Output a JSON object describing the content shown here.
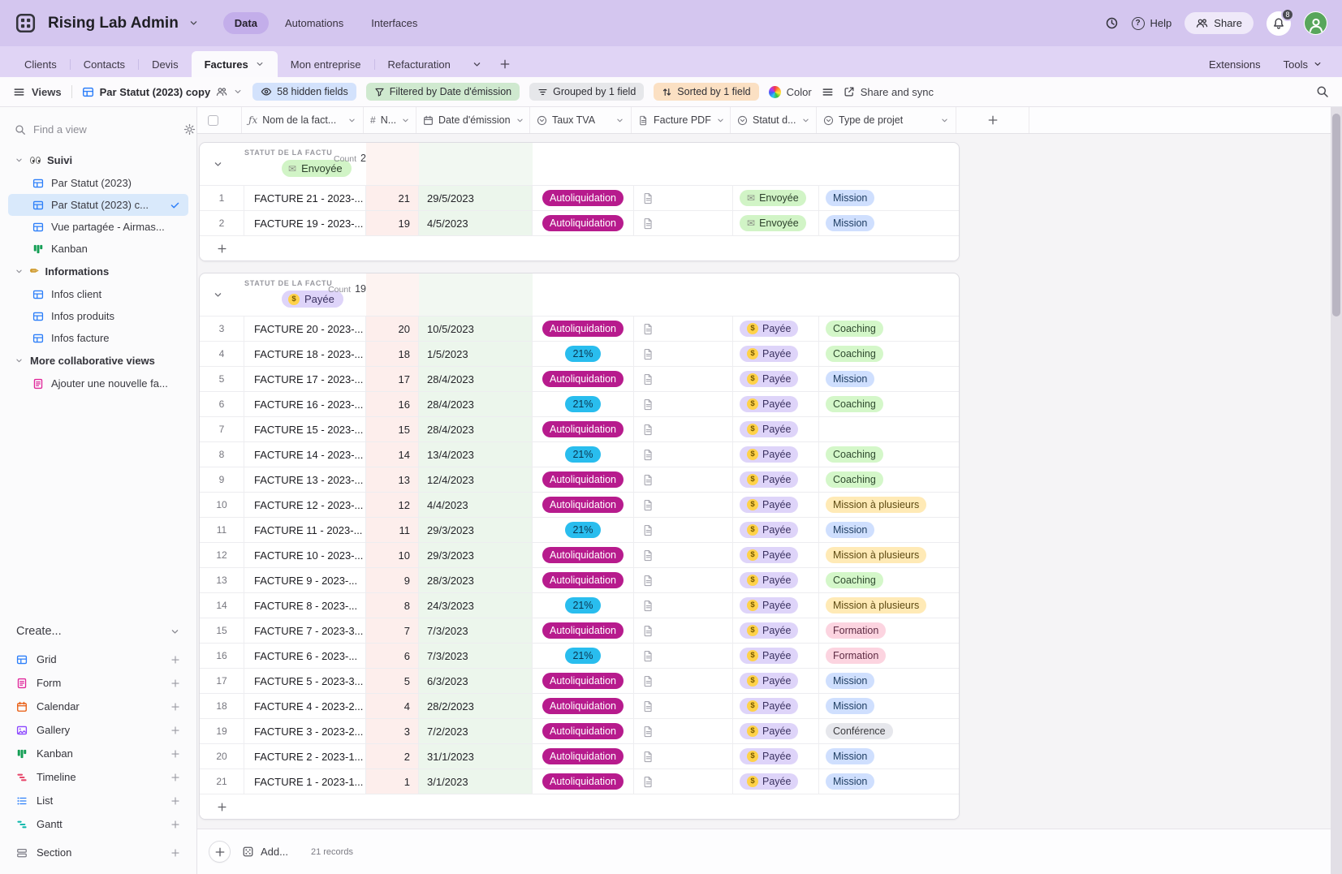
{
  "header": {
    "title": "Rising Lab Admin",
    "nav": [
      {
        "label": "Data",
        "active": true
      },
      {
        "label": "Automations",
        "active": false
      },
      {
        "label": "Interfaces",
        "active": false
      }
    ],
    "help": "Help",
    "share": "Share",
    "notification_badge": "8"
  },
  "tabs": {
    "items": [
      {
        "label": "Clients",
        "active": false
      },
      {
        "label": "Contacts",
        "active": false
      },
      {
        "label": "Devis",
        "active": false
      },
      {
        "label": "Factures",
        "active": true
      },
      {
        "label": "Mon entreprise",
        "active": false
      },
      {
        "label": "Refacturation",
        "active": false
      }
    ],
    "extensions": "Extensions",
    "tools": "Tools"
  },
  "toolbar": {
    "views": "Views",
    "view_name": "Par Statut (2023) copy",
    "hidden_fields": "58 hidden fields",
    "filtered": "Filtered by Date d'émission",
    "grouped": "Grouped by 1 field",
    "sorted": "Sorted by 1 field",
    "color": "Color",
    "share_sync": "Share and sync"
  },
  "sidebar": {
    "find_placeholder": "Find a view",
    "sections": [
      {
        "label": "Suivi",
        "emoji": "eyes-emoji",
        "items": [
          {
            "label": "Par Statut (2023)",
            "icon": "table-icon",
            "color": "#2d7ff9",
            "selected": false
          },
          {
            "label": "Par Statut (2023) c...",
            "icon": "table-icon",
            "color": "#2d7ff9",
            "selected": true
          },
          {
            "label": "Vue partagée - Airmas...",
            "icon": "table-icon",
            "color": "#2d7ff9",
            "selected": false
          },
          {
            "label": "Kanban",
            "icon": "kanban-icon",
            "color": "#149e55",
            "selected": false
          }
        ]
      },
      {
        "label": "Informations",
        "emoji": "pencil-emoji",
        "items": [
          {
            "label": "Infos client",
            "icon": "table-icon",
            "color": "#2d7ff9",
            "selected": false
          },
          {
            "label": "Infos produits",
            "icon": "table-icon",
            "color": "#2d7ff9",
            "selected": false
          },
          {
            "label": "Infos facture",
            "icon": "table-icon",
            "color": "#2d7ff9",
            "selected": false
          }
        ]
      },
      {
        "label": "More collaborative views",
        "emoji": "",
        "items": [
          {
            "label": "Ajouter une nouvelle fa...",
            "icon": "form-icon",
            "color": "#e0269a",
            "selected": false
          }
        ]
      }
    ],
    "create": {
      "label": "Create...",
      "items": [
        {
          "label": "Grid",
          "icon": "table-icon",
          "color": "#2d7ff9"
        },
        {
          "label": "Form",
          "icon": "form-icon",
          "color": "#e0269a"
        },
        {
          "label": "Calendar",
          "icon": "calendar-icon",
          "color": "#e8590c"
        },
        {
          "label": "Gallery",
          "icon": "gallery-icon",
          "color": "#8b46ff"
        },
        {
          "label": "Kanban",
          "icon": "kanban-icon",
          "color": "#149e55"
        },
        {
          "label": "Timeline",
          "icon": "timeline-icon",
          "color": "#e8476b"
        },
        {
          "label": "List",
          "icon": "list-icon",
          "color": "#2d7ff9"
        },
        {
          "label": "Gantt",
          "icon": "gantt-icon",
          "color": "#0fb8ad"
        },
        {
          "label": "Section",
          "icon": "section-icon",
          "color": "#7b7b85"
        }
      ]
    }
  },
  "grid": {
    "columns": [
      {
        "label": "Nom de la fact...",
        "icon": "fx-icon"
      },
      {
        "label": "N...",
        "icon": "hash-icon"
      },
      {
        "label": "Date d'émission",
        "icon": "calendar-icon"
      },
      {
        "label": "Taux TVA",
        "icon": "select-icon"
      },
      {
        "label": "Facture PDF",
        "icon": "file-icon"
      },
      {
        "label": "Statut d...",
        "icon": "select-icon"
      },
      {
        "label": "Type de projet",
        "icon": "select-icon"
      }
    ],
    "group_field_label": "STATUT DE LA FACTU",
    "count_label": "Count",
    "groups": [
      {
        "status": "Envoyée",
        "count": "2",
        "rows": [
          {
            "num": "1",
            "name": "FACTURE 21 - 2023-...",
            "invoice_no": "21",
            "date": "29/5/2023",
            "tva": "Autoliquidation",
            "statut": "Envoyée",
            "type": "Mission"
          },
          {
            "num": "2",
            "name": "FACTURE 19 - 2023-...",
            "invoice_no": "19",
            "date": "4/5/2023",
            "tva": "Autoliquidation",
            "statut": "Envoyée",
            "type": "Mission"
          }
        ]
      },
      {
        "status": "Payée",
        "count": "19",
        "rows": [
          {
            "num": "3",
            "name": "FACTURE 20 - 2023-...",
            "invoice_no": "20",
            "date": "10/5/2023",
            "tva": "Autoliquidation",
            "statut": "Payée",
            "type": "Coaching"
          },
          {
            "num": "4",
            "name": "FACTURE 18 - 2023-...",
            "invoice_no": "18",
            "date": "1/5/2023",
            "tva": "21%",
            "statut": "Payée",
            "type": "Coaching"
          },
          {
            "num": "5",
            "name": "FACTURE 17 - 2023-...",
            "invoice_no": "17",
            "date": "28/4/2023",
            "tva": "Autoliquidation",
            "statut": "Payée",
            "type": "Mission"
          },
          {
            "num": "6",
            "name": "FACTURE 16 - 2023-...",
            "invoice_no": "16",
            "date": "28/4/2023",
            "tva": "21%",
            "statut": "Payée",
            "type": "Coaching"
          },
          {
            "num": "7",
            "name": "FACTURE 15 - 2023-...",
            "invoice_no": "15",
            "date": "28/4/2023",
            "tva": "Autoliquidation",
            "statut": "Payée",
            "type": ""
          },
          {
            "num": "8",
            "name": "FACTURE 14 - 2023-...",
            "invoice_no": "14",
            "date": "13/4/2023",
            "tva": "21%",
            "statut": "Payée",
            "type": "Coaching"
          },
          {
            "num": "9",
            "name": "FACTURE 13 - 2023-...",
            "invoice_no": "13",
            "date": "12/4/2023",
            "tva": "Autoliquidation",
            "statut": "Payée",
            "type": "Coaching"
          },
          {
            "num": "10",
            "name": "FACTURE 12 - 2023-...",
            "invoice_no": "12",
            "date": "4/4/2023",
            "tva": "Autoliquidation",
            "statut": "Payée",
            "type": "Mission à plusieurs"
          },
          {
            "num": "11",
            "name": "FACTURE 11 - 2023-...",
            "invoice_no": "11",
            "date": "29/3/2023",
            "tva": "21%",
            "statut": "Payée",
            "type": "Mission"
          },
          {
            "num": "12",
            "name": "FACTURE 10 - 2023-...",
            "invoice_no": "10",
            "date": "29/3/2023",
            "tva": "Autoliquidation",
            "statut": "Payée",
            "type": "Mission à plusieurs"
          },
          {
            "num": "13",
            "name": "FACTURE 9 - 2023-...",
            "invoice_no": "9",
            "date": "28/3/2023",
            "tva": "Autoliquidation",
            "statut": "Payée",
            "type": "Coaching"
          },
          {
            "num": "14",
            "name": "FACTURE 8 - 2023-...",
            "invoice_no": "8",
            "date": "24/3/2023",
            "tva": "21%",
            "statut": "Payée",
            "type": "Mission à plusieurs"
          },
          {
            "num": "15",
            "name": "FACTURE 7 - 2023-3...",
            "invoice_no": "7",
            "date": "7/3/2023",
            "tva": "Autoliquidation",
            "statut": "Payée",
            "type": "Formation"
          },
          {
            "num": "16",
            "name": "FACTURE 6 - 2023-...",
            "invoice_no": "6",
            "date": "7/3/2023",
            "tva": "21%",
            "statut": "Payée",
            "type": "Formation"
          },
          {
            "num": "17",
            "name": "FACTURE 5 - 2023-3...",
            "invoice_no": "5",
            "date": "6/3/2023",
            "tva": "Autoliquidation",
            "statut": "Payée",
            "type": "Mission"
          },
          {
            "num": "18",
            "name": "FACTURE 4 - 2023-2...",
            "invoice_no": "4",
            "date": "28/2/2023",
            "tva": "Autoliquidation",
            "statut": "Payée",
            "type": "Mission"
          },
          {
            "num": "19",
            "name": "FACTURE 3 - 2023-2...",
            "invoice_no": "3",
            "date": "7/2/2023",
            "tva": "Autoliquidation",
            "statut": "Payée",
            "type": "Conférence"
          },
          {
            "num": "20",
            "name": "FACTURE 2 - 2023-1...",
            "invoice_no": "2",
            "date": "31/1/2023",
            "tva": "Autoliquidation",
            "statut": "Payée",
            "type": "Mission"
          },
          {
            "num": "21",
            "name": "FACTURE 1 - 2023-1...",
            "invoice_no": "1",
            "date": "3/1/2023",
            "tva": "Autoliquidation",
            "statut": "Payée",
            "type": "Mission"
          }
        ]
      }
    ],
    "footer": {
      "add_label": "Add...",
      "records": "21 records"
    }
  },
  "colors": {
    "topbar": "#d4c6ef",
    "tva": {
      "Autoliquidation": {
        "bg": "#b71b8d",
        "fg": "#ffffff"
      },
      "21%": {
        "bg": "#29bdee",
        "fg": "#0a3550"
      }
    },
    "statut": {
      "Envoyée": {
        "bg": "#d1f4c6",
        "fg": "#2c402c",
        "icon": "envelope-emoji"
      },
      "Payée": {
        "bg": "#ded4f9",
        "fg": "#3a3160",
        "icon": "money-emoji"
      }
    },
    "type": {
      "Mission": {
        "bg": "#cfdffe",
        "fg": "#1f3e63"
      },
      "Coaching": {
        "bg": "#d4f7c9",
        "fg": "#2f4a2f"
      },
      "Mission à plusieurs": {
        "bg": "#ffeab6",
        "fg": "#5d4a12"
      },
      "Formation": {
        "bg": "#fcd4e0",
        "fg": "#5e2b43"
      },
      "Conférence": {
        "bg": "#e6e7ec",
        "fg": "#3b3b3f"
      }
    }
  }
}
